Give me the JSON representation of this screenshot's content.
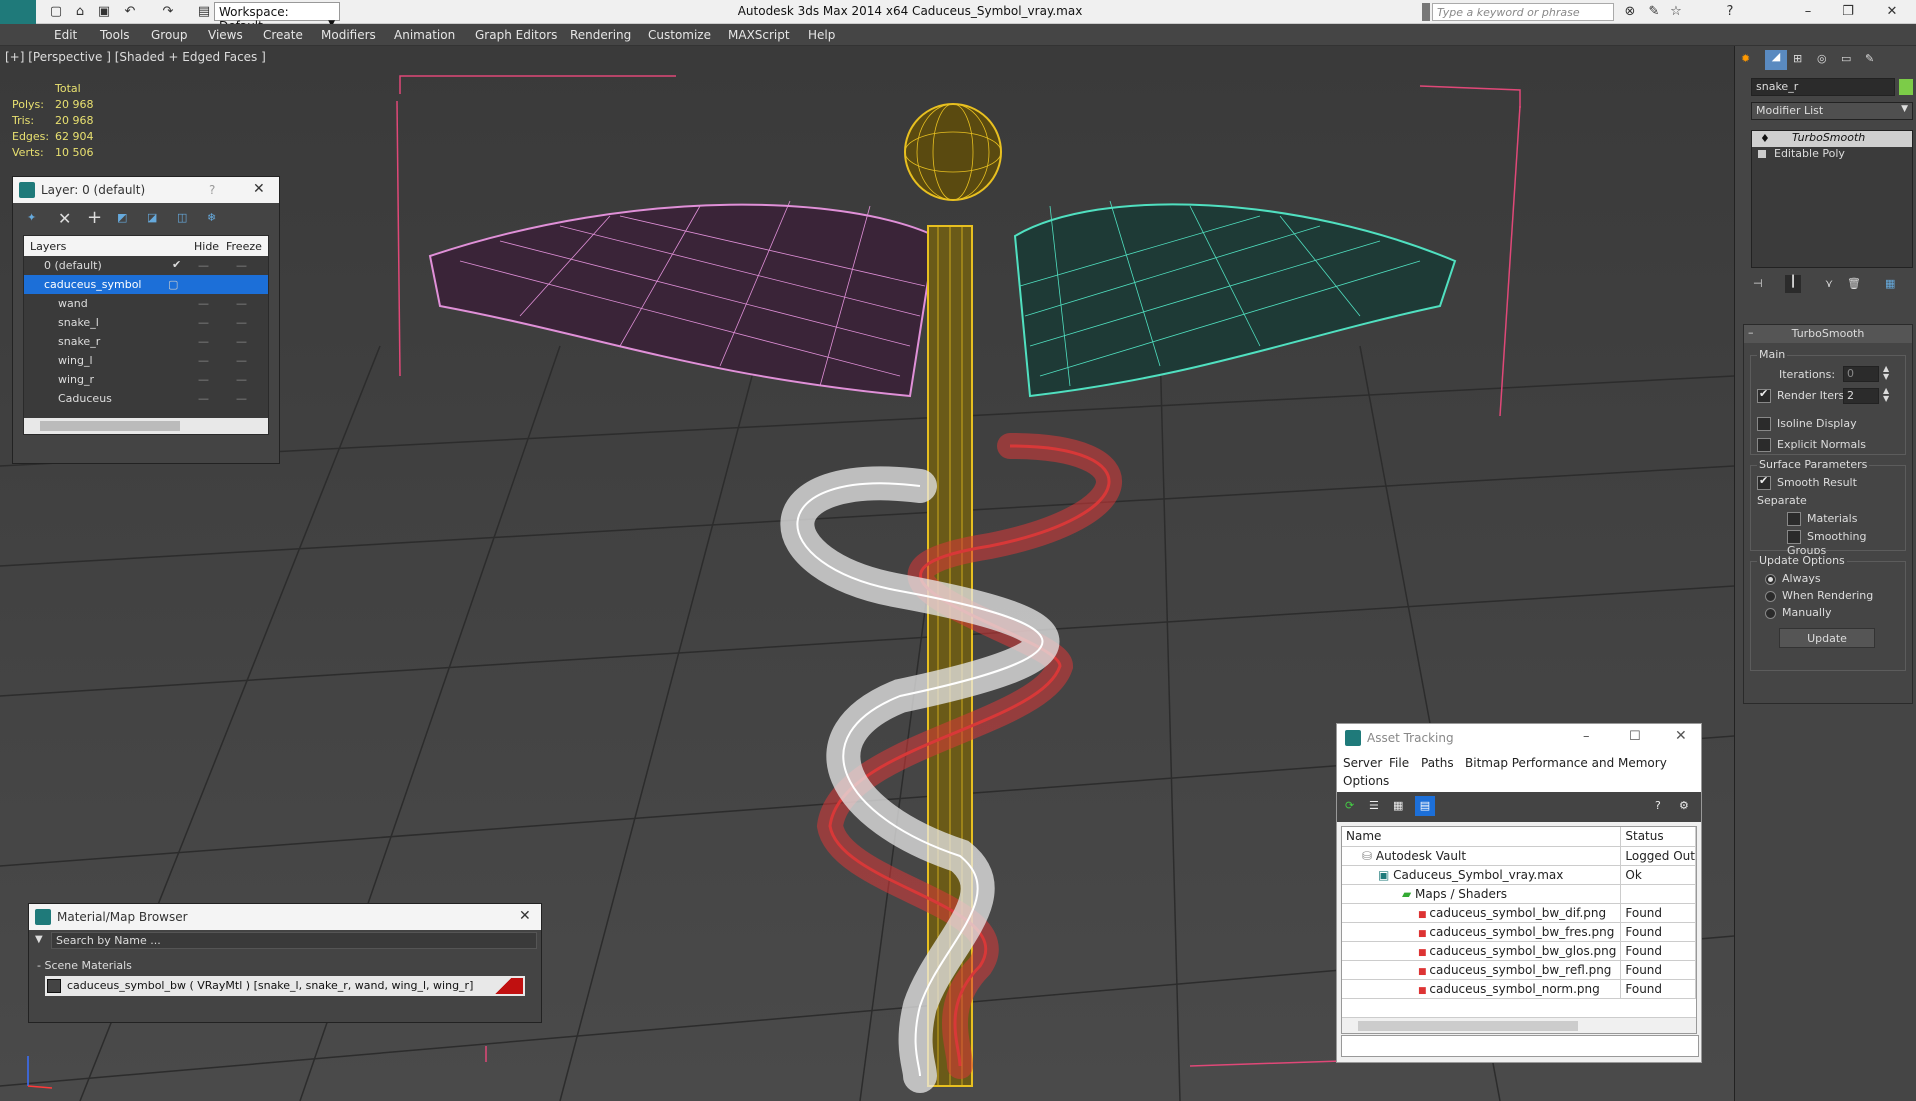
{
  "titlebar": {
    "workspace": "Workspace: Default",
    "title": "Autodesk 3ds Max  2014 x64     Caduceus_Symbol_vray.max",
    "search_placeholder": "Type a keyword or phrase"
  },
  "menu": [
    "Edit",
    "Tools",
    "Group",
    "Views",
    "Create",
    "Modifiers",
    "Animation",
    "Graph Editors",
    "Rendering",
    "Customize",
    "MAXScript",
    "Help"
  ],
  "viewport": {
    "label": "[+] [Perspective ] [Shaded + Edged Faces ]",
    "stats": {
      "header": "Total",
      "rows": [
        {
          "label": "Polys:",
          "value": "20 968"
        },
        {
          "label": "Tris:",
          "value": "20 968"
        },
        {
          "label": "Edges:",
          "value": "62 904"
        },
        {
          "label": "Verts:",
          "value": "10 506"
        }
      ]
    }
  },
  "layer_panel": {
    "title": "Layer: 0 (default)",
    "help": "?",
    "columns": {
      "layers": "Layers",
      "hide": "Hide",
      "freeze": "Freeze"
    },
    "rows": [
      {
        "name": "0 (default)",
        "level": 0
      },
      {
        "name": "caduceus_symbol",
        "level": 0
      },
      {
        "name": "wand",
        "level": 1
      },
      {
        "name": "snake_l",
        "level": 1
      },
      {
        "name": "snake_r",
        "level": 1
      },
      {
        "name": "wing_l",
        "level": 1
      },
      {
        "name": "wing_r",
        "level": 1
      },
      {
        "name": "Caduceus",
        "level": 1
      }
    ]
  },
  "material_browser": {
    "title": "Material/Map Browser",
    "search_placeholder": "Search by Name ...",
    "section": "- Scene Materials",
    "item": "caduceus_symbol_bw  ( VRayMtl ) [snake_l, snake_r, wand, wing_l, wing_r]"
  },
  "asset_tracking": {
    "title": "Asset Tracking",
    "menu": [
      "Server",
      "File",
      "Paths",
      "Bitmap Performance and Memory",
      "Options"
    ],
    "columns": {
      "name": "Name",
      "status": "Status"
    },
    "rows": [
      {
        "name": "Autodesk Vault",
        "status": "Logged Out",
        "level": 0
      },
      {
        "name": "Caduceus_Symbol_vray.max",
        "status": "Ok",
        "level": 1
      },
      {
        "name": "Maps / Shaders",
        "status": "",
        "level": 2
      },
      {
        "name": "caduceus_symbol_bw_dif.png",
        "status": "Found",
        "level": 3
      },
      {
        "name": "caduceus_symbol_bw_fres.png",
        "status": "Found",
        "level": 3
      },
      {
        "name": "caduceus_symbol_bw_glos.png",
        "status": "Found",
        "level": 3
      },
      {
        "name": "caduceus_symbol_bw_refl.png",
        "status": "Found",
        "level": 3
      },
      {
        "name": "caduceus_symbol_norm.png",
        "status": "Found",
        "level": 3
      }
    ]
  },
  "command_panel": {
    "object_name": "snake_r",
    "modifier_list": "Modifier List",
    "stack": [
      "TurboSmooth",
      "Editable Poly"
    ],
    "rollout": "TurboSmooth",
    "main": "Main",
    "iterations_label": "Iterations:",
    "iterations": "0",
    "render_iters_label": "Render Iters:",
    "render_iters": "2",
    "isoline": "Isoline Display",
    "explicit": "Explicit Normals",
    "surface": "Surface Parameters",
    "smooth_result": "Smooth Result",
    "separate": "Separate",
    "materials": "Materials",
    "smoothing_groups": "Smoothing Groups",
    "update_options": "Update Options",
    "always": "Always",
    "when_rendering": "When Rendering",
    "manually": "Manually",
    "update": "Update"
  },
  "colors": {
    "wing_l": "#e090d8",
    "wing_r": "#50e0c0",
    "wand": "#e8c020",
    "snake_l": "#e8e8e8",
    "snake_r": "#d83838",
    "accent": "#1f7a7a"
  }
}
